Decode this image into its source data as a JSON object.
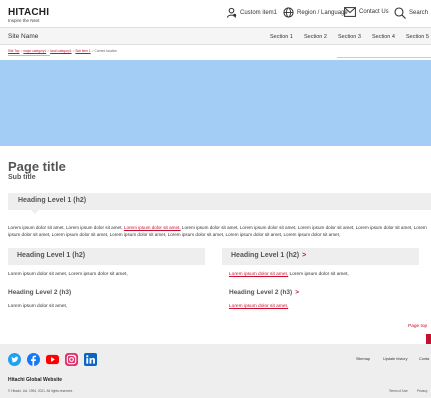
{
  "header": {
    "logo": "HITACHI",
    "tagline": "Inspire the Next",
    "utility": {
      "custom_item": "Custom item1",
      "region": "Region / Language",
      "contact": "Contact Us",
      "search": "Search"
    }
  },
  "sitebar": {
    "site_name": "Site Name",
    "sections": [
      "Section 1",
      "Section 2",
      "Section 3",
      "Section 4",
      "Section 5"
    ]
  },
  "breadcrumb": {
    "items": [
      "Site Top",
      "major category1",
      "local category1",
      "Sub item 1"
    ],
    "separator": ">",
    "current": "Current location"
  },
  "page": {
    "title": "Page title",
    "subtitle": "Sub title",
    "h2_wide": "Heading Level 1 (h2)",
    "para_pre": "Lorem ipsum dolor sit amet, Lorem ipsum dolor sit amet, ",
    "para_link": "Lorem ipsum dolor sit amet,",
    "para_post": " Lorem ipsum dolor sit amet, Lorem ipsum dolor sit amet, Lorem ipsum dolor sit amet, Lorem ipsum dolor sit amet, Lorem ipsum dolor sit amet, Lorem ipsum dolor sit amet, Lorem ipsum dolor sit amet, Lorem ipsum dolor sit amet, Lorem ipsum dolor sit amet, Lorem ipsum dolor sit amet,",
    "left": {
      "h2": "Heading Level 1 (h2)",
      "text1": "Lorem ipsum dolor sit amet, Lorem ipsum dolor sit amet,",
      "h3": "Heading Level 2 (h3)",
      "text2": "Lorem ipsum dolor sit amet,"
    },
    "right": {
      "h2": "Heading Level 1 (h2)",
      "text1_link": "Lorem ipsum dolor sit amet,",
      "text1_post": " Lorem ipsum dolor sit amet,",
      "h3": "Heading Level 2 (h3)",
      "text2_link": "Lorem ipsum dolor sit amet,"
    },
    "chevron": ">",
    "pagetop": "Page top"
  },
  "footer": {
    "links": [
      "Sitemap",
      "Update history",
      "Conta"
    ],
    "title": "Hitachi Global Website",
    "copyright": "© Hitachi, Ltd. 1994, 2021. All rights reserved.",
    "bottom_links": [
      "Terms of Use",
      "Privacy"
    ]
  },
  "colors": {
    "accent": "#c8102e",
    "hero": "#a4cdf6",
    "panel": "#eeeeee",
    "twitter": "#1da1f2",
    "facebook": "#1877f2",
    "youtube": "#ff0000",
    "instagram": "#e1306c",
    "linkedin": "#0a66c2"
  },
  "icons": [
    "custom-item-icon",
    "globe-icon",
    "mail-icon",
    "search-icon",
    "twitter-icon",
    "facebook-icon",
    "youtube-icon",
    "instagram-icon",
    "linkedin-icon"
  ]
}
